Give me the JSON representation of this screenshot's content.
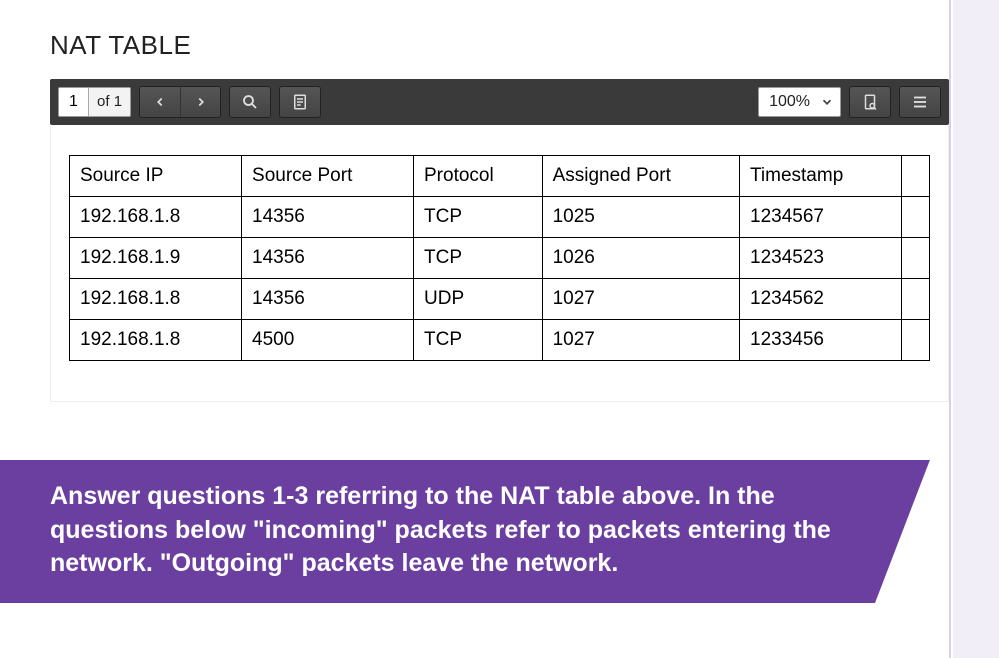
{
  "title": "NAT TABLE",
  "toolbar": {
    "page_current": "1",
    "page_of_prefix": "of ",
    "page_total": "1",
    "zoom_label": "100%"
  },
  "table": {
    "headers": [
      "Source IP",
      "Source Port",
      "Protocol",
      "Assigned Port",
      "Timestamp"
    ],
    "rows": [
      [
        "192.168.1.8",
        "14356",
        "TCP",
        "1025",
        "1234567"
      ],
      [
        "192.168.1.9",
        "14356",
        "TCP",
        "1026",
        "1234523"
      ],
      [
        "192.168.1.8",
        "14356",
        "UDP",
        "1027",
        "1234562"
      ],
      [
        "192.168.1.8",
        "4500",
        "TCP",
        "1027",
        "1233456"
      ]
    ]
  },
  "instructions": "Answer questions 1-3 referring to the NAT table above. In the questions below \"incoming\" packets refer to packets entering the network. \"Outgoing\" packets leave the network."
}
